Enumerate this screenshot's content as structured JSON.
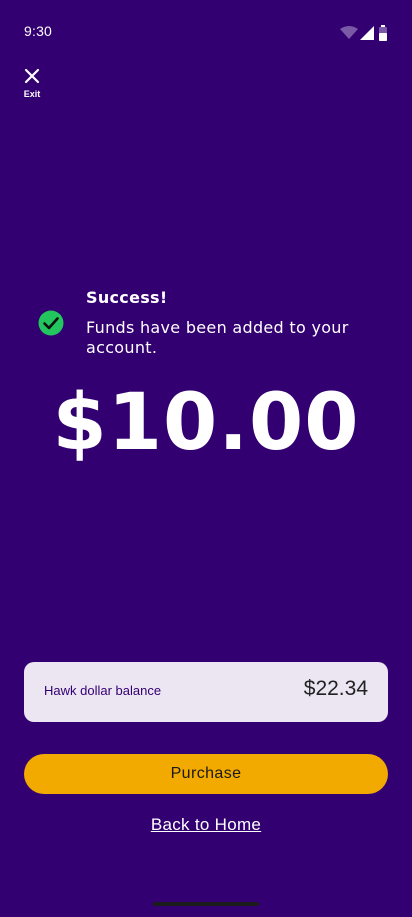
{
  "status_bar": {
    "time": "9:30",
    "icons": [
      "wifi-icon",
      "signal-icon",
      "battery-icon"
    ]
  },
  "header": {
    "exit_label": "Exit",
    "exit_icon": "close-icon"
  },
  "success": {
    "title": "Success!",
    "message": "Funds have been added to your account.",
    "icon": "check-circle-icon",
    "icon_color": "#22c55e"
  },
  "amount": "$10.00",
  "balance": {
    "label": "Hawk dollar balance",
    "value": "$22.34"
  },
  "actions": {
    "purchase_label": "Purchase",
    "back_home_label": "Back to Home"
  },
  "colors": {
    "background": "#330072",
    "accent": "#f2a900",
    "card": "#ece6f2"
  }
}
